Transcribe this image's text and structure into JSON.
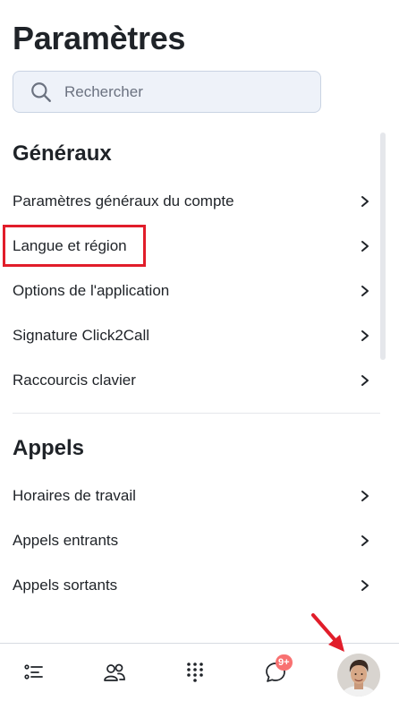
{
  "page": {
    "title": "Paramètres"
  },
  "search": {
    "placeholder": "Rechercher",
    "value": ""
  },
  "sections": [
    {
      "heading": "Généraux",
      "items": [
        {
          "label": "Paramètres généraux du compte"
        },
        {
          "label": "Langue et région"
        },
        {
          "label": "Options de l'application"
        },
        {
          "label": "Signature Click2Call"
        },
        {
          "label": "Raccourcis clavier"
        }
      ]
    },
    {
      "heading": "Appels",
      "items": [
        {
          "label": "Horaires de travail"
        },
        {
          "label": "Appels entrants"
        },
        {
          "label": "Appels sortants"
        }
      ]
    }
  ],
  "bottom_nav": {
    "items": [
      {
        "icon": "list-icon"
      },
      {
        "icon": "contacts-icon"
      },
      {
        "icon": "dialpad-icon"
      },
      {
        "icon": "chat-icon",
        "badge": "9+"
      },
      {
        "icon": "avatar"
      }
    ]
  },
  "colors": {
    "highlight": "#e11d2a",
    "badge": "#f87171",
    "search_bg": "#eef2f9",
    "text": "#1f2328"
  }
}
